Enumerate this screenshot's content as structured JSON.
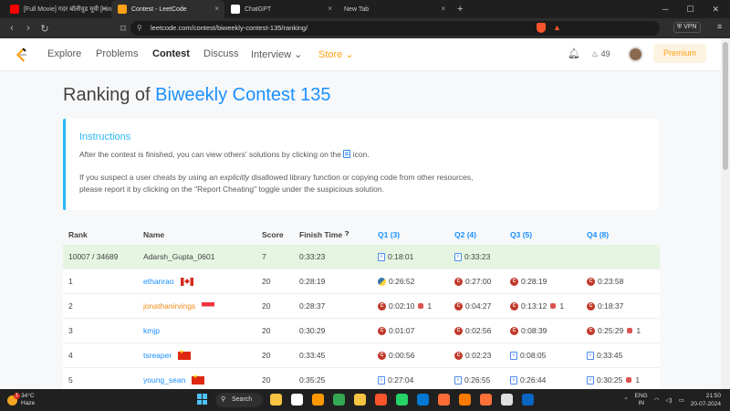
{
  "browser": {
    "tabs": [
      {
        "label": "[Full Movie] गदर बॉलीवुड मूवी [Hindi D",
        "active": false,
        "color": "#ff0000"
      },
      {
        "label": "Contest - LeetCode",
        "active": true,
        "color": "#ffa116"
      },
      {
        "label": "ChatGPT",
        "active": false,
        "color": "#ffffff"
      },
      {
        "label": "New Tab",
        "active": false,
        "color": ""
      }
    ],
    "new_tab": "+",
    "url": "leetcode.com/contest/biweekly-contest-135/ranking/",
    "vpn": "VPN"
  },
  "nav": {
    "items": [
      "Explore",
      "Problems",
      "Contest",
      "Discuss",
      "Interview",
      "Store"
    ],
    "active": "Contest",
    "streak": "49",
    "premium": "Premium"
  },
  "page": {
    "title_prefix": "Ranking of ",
    "contest_name": "Biweekly Contest 135",
    "instructions": {
      "heading": "Instructions",
      "line1_a": "After the contest is finished, you can view others' solutions by clicking on the ",
      "line1_b": " icon.",
      "line2_a": "If you suspect a user cheats by using an ",
      "line2_em": "explicitly",
      "line2_b": " disallowed library function or copying code from other resources,",
      "line3": "please report it by clicking on the \"Report Cheating\" toggle under the suspicious solution."
    }
  },
  "table": {
    "headers": [
      "Rank",
      "Name",
      "Score",
      "Finish Time",
      "Q1 (3)",
      "Q2 (4)",
      "Q3 (5)",
      "Q4 (8)"
    ],
    "rows": [
      {
        "rank": "10007 / 34689",
        "name": "Adarsh_Gupta_0601",
        "flag": "",
        "score": "7",
        "finish": "0:33:23",
        "q": [
          [
            "doc",
            "0:18:01",
            ""
          ],
          [
            "doc",
            "0:33:23",
            ""
          ],
          [
            "",
            "",
            ""
          ],
          [
            "",
            "",
            ""
          ]
        ],
        "me": true,
        "orange": false
      },
      {
        "rank": "1",
        "name": "ethanrao",
        "flag": "ca",
        "score": "20",
        "finish": "0:28:19",
        "q": [
          [
            "py",
            "0:26:52",
            ""
          ],
          [
            "c",
            "0:27:00",
            ""
          ],
          [
            "c",
            "0:28:19",
            ""
          ],
          [
            "c",
            "0:23:58",
            ""
          ]
        ],
        "me": false,
        "orange": false
      },
      {
        "rank": "2",
        "name": "jonathanirvings",
        "flag": "sg",
        "score": "20",
        "finish": "0:28:37",
        "q": [
          [
            "c",
            "0:02:10",
            "1"
          ],
          [
            "c",
            "0:04:27",
            ""
          ],
          [
            "c",
            "0:13:12",
            "1"
          ],
          [
            "c",
            "0:18:37",
            ""
          ]
        ],
        "me": false,
        "orange": true
      },
      {
        "rank": "3",
        "name": "kmjp",
        "flag": "",
        "score": "20",
        "finish": "0:30:29",
        "q": [
          [
            "c",
            "0:01:07",
            ""
          ],
          [
            "c",
            "0:02:56",
            ""
          ],
          [
            "c",
            "0:08:39",
            ""
          ],
          [
            "c",
            "0:25:29",
            "1"
          ]
        ],
        "me": false,
        "orange": false
      },
      {
        "rank": "4",
        "name": "tsreaper",
        "flag": "cn",
        "score": "20",
        "finish": "0:33:45",
        "q": [
          [
            "c",
            "0:00:56",
            ""
          ],
          [
            "c",
            "0:02:23",
            ""
          ],
          [
            "doc",
            "0:08:05",
            ""
          ],
          [
            "doc",
            "0:33:45",
            ""
          ]
        ],
        "me": false,
        "orange": false
      },
      {
        "rank": "5",
        "name": "young_sean",
        "flag": "cn",
        "score": "20",
        "finish": "0:35:25",
        "q": [
          [
            "doc",
            "0:27:04",
            ""
          ],
          [
            "doc",
            "0:26:55",
            ""
          ],
          [
            "doc",
            "0:26:44",
            ""
          ],
          [
            "doc",
            "0:30:25",
            "1"
          ]
        ],
        "me": false,
        "orange": false
      }
    ]
  },
  "taskbar": {
    "weather_temp": "34°C",
    "weather_desc": "Haze",
    "search": "Search",
    "lang1": "ENG",
    "lang2": "IN",
    "time": "21:50",
    "date": "20-07-2024"
  }
}
